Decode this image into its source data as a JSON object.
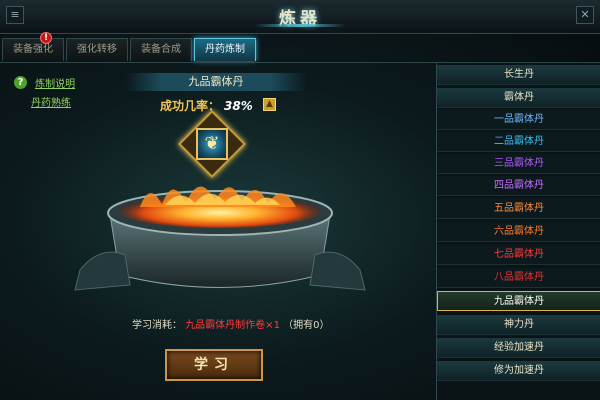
{
  "window": {
    "title": "炼器",
    "left_button_icon": "menu-icon",
    "right_button_icon": "close-icon"
  },
  "tabs": [
    {
      "label": "装备强化",
      "active": false
    },
    {
      "label": "强化转移",
      "active": false
    },
    {
      "label": "装备合成",
      "active": false
    },
    {
      "label": "丹药炼制",
      "active": true
    }
  ],
  "notification_badge": "!",
  "help_links": {
    "refine_help": "炼制说明",
    "pill_mastery": "丹药熟练"
  },
  "current_pill": {
    "name": "九品霸体丹",
    "success_label": "成功几率：",
    "success_rate": "38%"
  },
  "cost": {
    "label": "学习消耗：",
    "item": "九品霸体丹制作卷×1",
    "owned": "（拥有0）"
  },
  "learn_button": "学习",
  "pill_list": [
    {
      "label": "长生丹",
      "type": "header",
      "color": "#e9e1c5"
    },
    {
      "label": "霸体丹",
      "type": "header",
      "color": "#e9e1c5"
    },
    {
      "label": "一品霸体丹",
      "type": "sub",
      "color": "#6ab7ff"
    },
    {
      "label": "二品霸体丹",
      "type": "sub",
      "color": "#39bff5"
    },
    {
      "label": "三品霸体丹",
      "type": "sub",
      "color": "#b158ff"
    },
    {
      "label": "四品霸体丹",
      "type": "sub",
      "color": "#c46bff"
    },
    {
      "label": "五品霸体丹",
      "type": "sub",
      "color": "#ff8a3c"
    },
    {
      "label": "六品霸体丹",
      "type": "sub",
      "color": "#ff7a2c"
    },
    {
      "label": "七品霸体丹",
      "type": "sub",
      "color": "#ff3838"
    },
    {
      "label": "八品霸体丹",
      "type": "sub",
      "color": "#e83030"
    },
    {
      "label": "九品霸体丹",
      "type": "sub",
      "color": "#ffffff",
      "selected": true
    },
    {
      "label": "神力丹",
      "type": "header",
      "color": "#e9e1c5"
    },
    {
      "label": "经验加速丹",
      "type": "header",
      "color": "#e9e1c5"
    },
    {
      "label": "修为加速丹",
      "type": "header",
      "color": "#e9e1c5"
    }
  ]
}
